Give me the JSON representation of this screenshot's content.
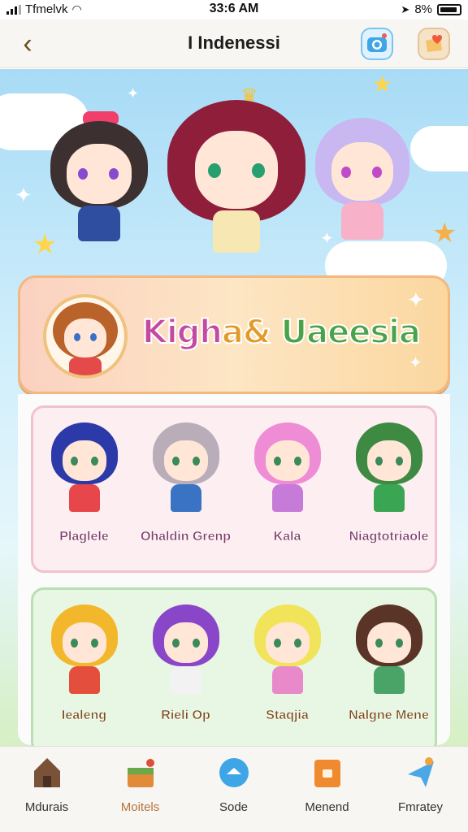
{
  "status": {
    "carrier": "Tfmelvk",
    "time": "33:6 AM",
    "battery": "8%"
  },
  "nav": {
    "title": "I Indenessi"
  },
  "banner": {
    "title_parts": [
      "Kigh",
      "a&",
      " Uaeesia"
    ]
  },
  "pink_row": [
    {
      "name": "Plaglele",
      "hair": "#2b3aa8",
      "outfit": "#e7464b"
    },
    {
      "name": "Ohaldin Grenp",
      "hair": "#b8adb9",
      "outfit": "#3a73c4"
    },
    {
      "name": "Kala",
      "hair": "#ef8cd6",
      "outfit": "#c67bd8"
    },
    {
      "name": "Niagtotriaole",
      "hair": "#3f8a43",
      "outfit": "#3aa654"
    }
  ],
  "green_row": [
    {
      "name": "Iealeng",
      "hair": "#f3b72c",
      "outfit": "#e44f3d"
    },
    {
      "name": "Rieli Op",
      "hair": "#8a46c9",
      "outfit": "#f2f2f2"
    },
    {
      "name": "Staqjia",
      "hair": "#f1e35a",
      "outfit": "#e889c9"
    },
    {
      "name": "Nalgne Mene",
      "hair": "#5a3427",
      "outfit": "#4aa367"
    }
  ],
  "tabs": [
    {
      "label": "Mdurais",
      "icon": "house-icon",
      "active": false
    },
    {
      "label": "Moitels",
      "icon": "gift-box-icon",
      "active": true
    },
    {
      "label": "Sode",
      "icon": "chat-bubble-icon",
      "active": false
    },
    {
      "label": "Menend",
      "icon": "orange-box-icon",
      "active": false
    },
    {
      "label": "Fmratey",
      "icon": "paper-plane-icon",
      "active": false
    }
  ],
  "colors": {
    "banner_border": "#f3b87f",
    "pink_panel": "#fdeff1",
    "green_panel": "#e8f7e3",
    "active_tab": "#b7733a"
  }
}
